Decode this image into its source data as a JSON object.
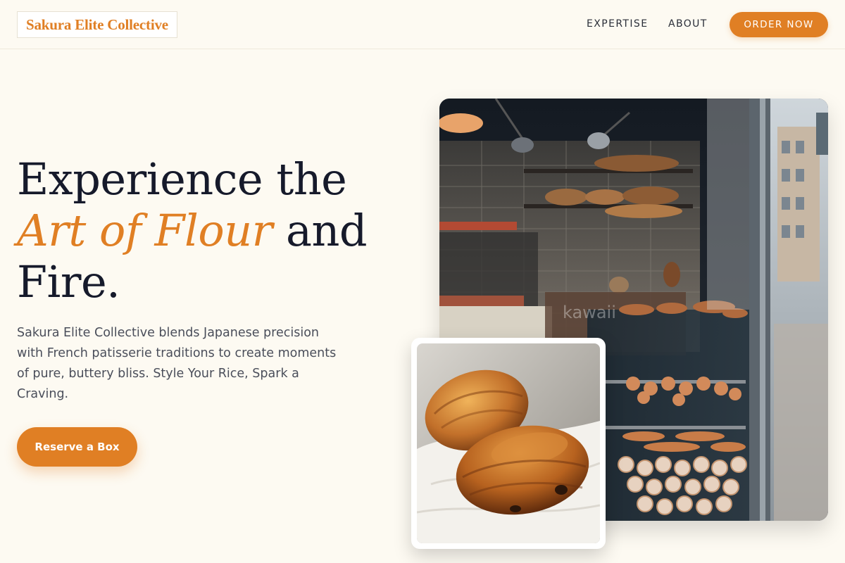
{
  "brand": {
    "name": "Sakura Elite Collective",
    "color": "#e07f24"
  },
  "nav": {
    "links": [
      {
        "label": "EXPERTISE"
      },
      {
        "label": "ABOUT"
      }
    ],
    "cta_label": "ORDER NOW"
  },
  "hero": {
    "headline_part1": "Experience the",
    "headline_accent": "Art of Flour",
    "headline_part2": " and",
    "headline_part3": "Fire.",
    "description": "Sakura Elite Collective blends Japanese precision with French patisserie traditions to create moments of pure, buttery bliss. Style Your Rice, Spark a Craving.",
    "button_label": "Reserve a Box"
  },
  "images": {
    "main": "bakery-storefront-photo",
    "inset": "croissant-closeup-photo",
    "watermark": "kawaii"
  },
  "colors": {
    "background": "#fdfaf2",
    "accent": "#e07f24",
    "heading": "#161a2b",
    "body_text": "#4a4e5a"
  }
}
